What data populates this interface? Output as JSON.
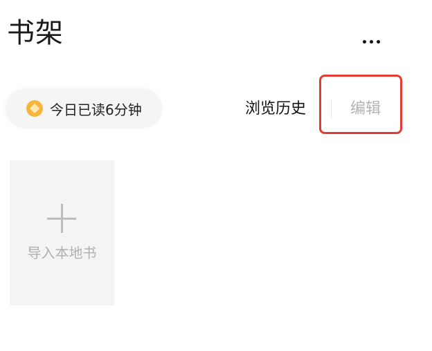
{
  "header": {
    "title": "书架",
    "more_icon": "more-horizontal-icon"
  },
  "reading_stats": {
    "icon": "coin-icon",
    "label": "今日已读6分钟",
    "coin_color": "#f4b63f"
  },
  "actions": {
    "history_label": "浏览历史",
    "edit_label": "编辑",
    "highlight_color": "#e43a30"
  },
  "shelf": {
    "import_card": {
      "icon": "plus-icon",
      "label": "导入本地书"
    }
  }
}
